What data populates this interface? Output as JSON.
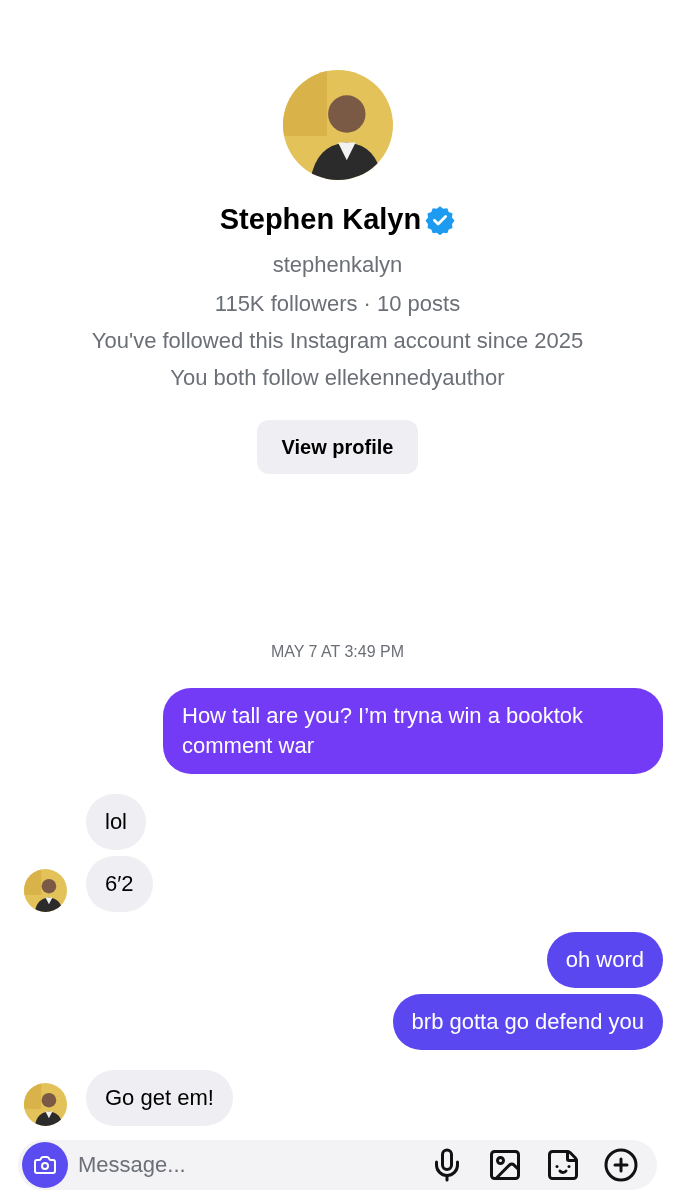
{
  "profile": {
    "name": "Stephen Kalyn",
    "verified": true,
    "username": "stephenkalyn",
    "stats": "115K followers · 10 posts",
    "info": [
      "You've followed this Instagram account since 2025",
      "You both follow ellekennedyauthor"
    ],
    "button": "View profile"
  },
  "timestamp": "MAY 7 AT 3:49 PM",
  "messages": [
    {
      "kind": "sent",
      "text": "How tall are you? I’m tryna win a booktok comment war"
    },
    {
      "kind": "received",
      "text": "lol",
      "avatar": false
    },
    {
      "kind": "received",
      "text": "6′2",
      "avatar": true
    },
    {
      "kind": "sent",
      "text": "oh word"
    },
    {
      "kind": "sent",
      "text": "brb gotta go defend you"
    },
    {
      "kind": "received",
      "text": "Go get em!",
      "avatar": true
    }
  ],
  "composer": {
    "placeholder": "Message..."
  }
}
